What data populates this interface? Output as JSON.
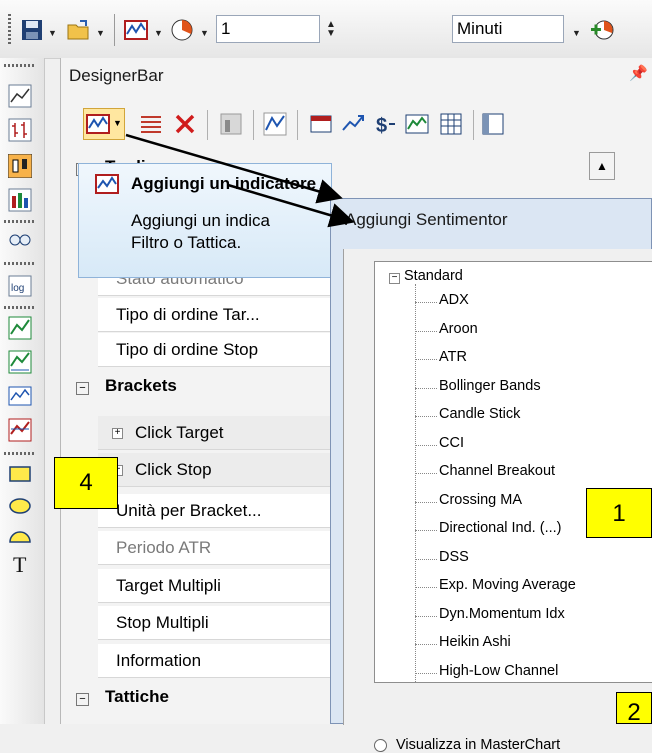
{
  "toolbar": {
    "number_value": "1",
    "unit_value": "Minuti"
  },
  "panel": {
    "title": "DesignerBar",
    "pin_icon": "pin-icon"
  },
  "grid": {
    "top_category": "Trading",
    "rows_top": [
      "Stato automatico",
      "Tipo di ordine Tar...",
      "Tipo di ordine Stop"
    ],
    "rows_top_grey": [
      true,
      false,
      false
    ],
    "brackets": "Brackets",
    "bracket_subs": [
      "Click Target",
      "Click Stop"
    ],
    "rows_mid": [
      "Unità per Bracket...",
      "Periodo ATR",
      "Target Multipli",
      "Stop Multipli",
      "Information"
    ],
    "rows_mid_grey": [
      false,
      true,
      false,
      false,
      false
    ],
    "tactics": "Tattiche",
    "collapse_symbol": "−",
    "expand_symbol": "+"
  },
  "tooltip": {
    "title": "Aggiungi un indicatore",
    "body_line1": "Aggiungi un indica",
    "body_line2": "Filtro o Tattica."
  },
  "dialog": {
    "title": "Aggiungi Sentimentor",
    "root": "Standard",
    "items": [
      "ADX",
      "Aroon",
      "ATR",
      "Bollinger Bands",
      "Candle Stick",
      "CCI",
      "Channel Breakout",
      "Crossing MA",
      "Directional Ind. (...)",
      "DSS",
      "Exp. Moving Average",
      "Dyn.Momentum Idx",
      "Heikin Ashi",
      "High-Low Channel"
    ],
    "radio_label": "Visualizza in MasterChart"
  },
  "callouts": {
    "c1": "1",
    "c2": "2",
    "c4": "4"
  },
  "colors": {
    "callout": "#ffff00",
    "tooltip_bg": "#d7e9f7",
    "dialog_bg": "#dbe6f3"
  }
}
